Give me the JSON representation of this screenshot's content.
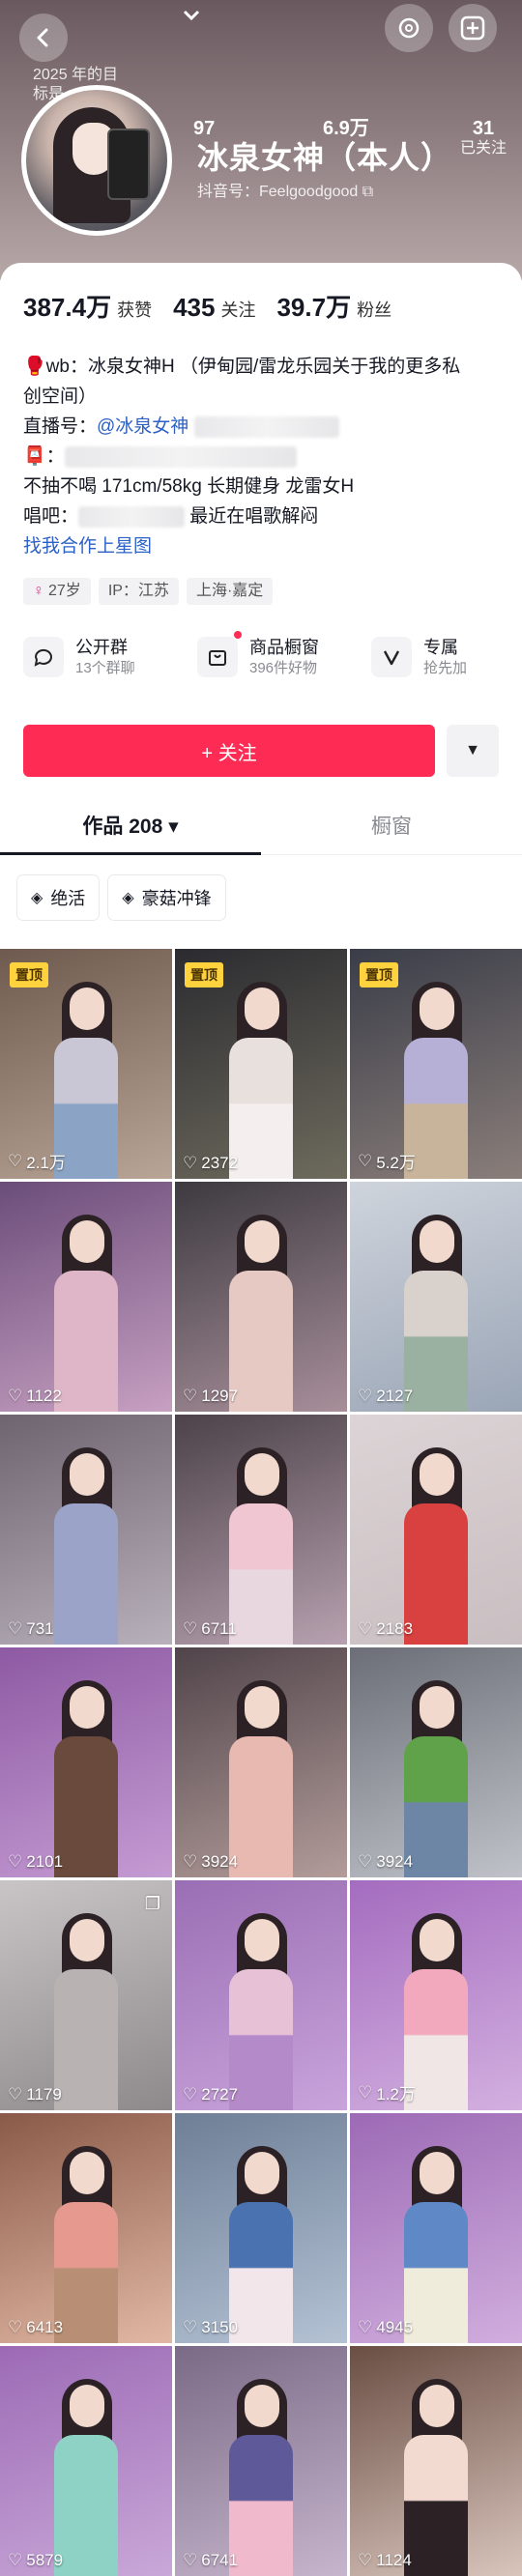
{
  "header": {
    "back_icon": "chevron-left-icon",
    "goal_text": [
      "2025 年的目",
      "标是"
    ],
    "top_icons": [
      "threads-icon",
      "plus-icon"
    ],
    "nickname": "冰泉女神（本人）",
    "douyin_id": "抖音号：Feelgoodgood",
    "header_stats": [
      {
        "value": "97",
        "label": ""
      },
      {
        "value": "6.9万",
        "label": ""
      },
      {
        "value": "31",
        "label": "已关注"
      }
    ]
  },
  "stats": [
    {
      "value": "387.4万",
      "label": "获赞"
    },
    {
      "value": "435",
      "label": "关注"
    },
    {
      "value": "39.7万",
      "label": "粉丝"
    }
  ],
  "bio": {
    "line1": "🥊wb：冰泉女神H （伊甸园/雷龙乐园关于我的更多私",
    "line2": "创空间）",
    "live_prefix": "直播号：",
    "live_link": "@冰泉女神",
    "mail_prefix": "📮：",
    "line5": "不抽不喝 171cm/58kg 长期健身 龙雷女H",
    "sing_prefix": "唱吧：",
    "sing_suffix": "最近在唱歌解闷",
    "collab_link": "找我合作上星图"
  },
  "tags": {
    "age": "27岁",
    "ip": "IP：江苏",
    "location": "上海·嘉定"
  },
  "entries": [
    {
      "title": "公开群",
      "sub": "13个群聊",
      "icon": "chat-group-icon"
    },
    {
      "title": "商品橱窗",
      "sub": "396件好物",
      "icon": "shop-bag-icon"
    },
    {
      "title": "专属",
      "sub": "抢先加",
      "icon": "v-badge-icon"
    }
  ],
  "follow_label": "+ 关注",
  "tabs": {
    "works": "作品 208 ▾",
    "showcase": "橱窗"
  },
  "collections": [
    {
      "label": "绝活",
      "icon": "layers-icon"
    },
    {
      "label": "豪菇冲锋",
      "icon": "layers-icon"
    }
  ],
  "pin_label": "置顶",
  "colors": {
    "accent": "#fe2c55",
    "link": "#2d61c5",
    "pin": "#ffd23e"
  },
  "videos": [
    {
      "likes": "2.1万",
      "pinned": true,
      "bg": [
        "#6e5a4e",
        "#b9a596"
      ],
      "top": "#c9c6d6",
      "bottom": "#8ba3c4"
    },
    {
      "likes": "2372",
      "pinned": true,
      "bg": [
        "#2b2b30",
        "#6e6b5d"
      ],
      "top": "#e8e0dc",
      "bottom": "#f4eeee"
    },
    {
      "likes": "5.2万",
      "pinned": true,
      "bg": [
        "#3a3d48",
        "#8a7e7a"
      ],
      "top": "#b7b0d6",
      "bottom": "#c7b49a"
    },
    {
      "likes": "1122",
      "pinned": false,
      "bg": [
        "#6b4d7a",
        "#c7a0c2"
      ],
      "top": "#dfb6c7",
      "bottom": "#dfb6c7"
    },
    {
      "likes": "1297",
      "pinned": false,
      "bg": [
        "#3d3a40",
        "#a88f9a"
      ],
      "top": "#e6c9c2",
      "bottom": "#e6c9c2"
    },
    {
      "likes": "2127",
      "pinned": false,
      "bg": [
        "#cfd4dc",
        "#9aa5b6"
      ],
      "top": "#d9d2cc",
      "bottom": "#9ab0a0"
    },
    {
      "likes": "731",
      "pinned": false,
      "bg": [
        "#6e6470",
        "#b8b0ba"
      ],
      "top": "#9ba3c8",
      "bottom": "#9ba3c8"
    },
    {
      "likes": "6711",
      "pinned": false,
      "bg": [
        "#4c4248",
        "#b7a1b0"
      ],
      "top": "#f0c6d2",
      "bottom": "#e8d7de"
    },
    {
      "likes": "2183",
      "pinned": false,
      "bg": [
        "#dcd4d6",
        "#c9bec1"
      ],
      "top": "#d8413f",
      "bottom": "#d8413f"
    },
    {
      "likes": "2101",
      "pinned": false,
      "bg": [
        "#8d5aa3",
        "#c59bd3"
      ],
      "top": "#6a4a3c",
      "bottom": "#6a4a3c"
    },
    {
      "likes": "3924",
      "pinned": false,
      "bg": [
        "#50444a",
        "#b39c9a"
      ],
      "top": "#e7b9b0",
      "bottom": "#e7b9b0"
    },
    {
      "likes": "3924",
      "pinned": false,
      "bg": [
        "#6b6e76",
        "#bfc3c9"
      ],
      "top": "#5fa24a",
      "bottom": "#6d86a6"
    },
    {
      "likes": "1179",
      "pinned": false,
      "multi": true,
      "bg": [
        "#c9c5c6",
        "#8e8a8c"
      ],
      "top": "#b8b2b3",
      "bottom": "#b8b2b3"
    },
    {
      "likes": "2727",
      "pinned": false,
      "bg": [
        "#9a6eb4",
        "#c9a4db"
      ],
      "top": "#e7c1d6",
      "bottom": "#b58ac9"
    },
    {
      "likes": "1.2万",
      "pinned": false,
      "bg": [
        "#a46cbf",
        "#d3b0e0"
      ],
      "top": "#f3a9bd",
      "bottom": "#f0e6e6"
    },
    {
      "likes": "6413",
      "pinned": false,
      "bg": [
        "#8a5a48",
        "#e2b8a4"
      ],
      "top": "#e69a8f",
      "bottom": "#b88f74"
    },
    {
      "likes": "3150",
      "pinned": false,
      "bg": [
        "#6e7f96",
        "#b4c2d4"
      ],
      "top": "#4a71b0",
      "bottom": "#f2e6ea"
    },
    {
      "likes": "4945",
      "pinned": false,
      "bg": [
        "#9c6ab5",
        "#d1aede"
      ],
      "top": "#5e88c6",
      "bottom": "#f0ecdc"
    },
    {
      "likes": "5879",
      "pinned": false,
      "bg": [
        "#9c6ab5",
        "#c9a8d8"
      ],
      "top": "#8dd2c5",
      "bottom": "#8dd2c5"
    },
    {
      "likes": "6741",
      "pinned": false,
      "bg": [
        "#7a6a86",
        "#c6b5cc"
      ],
      "top": "#5e5a9a",
      "bottom": "#f1b9cc"
    },
    {
      "likes": "1124",
      "pinned": false,
      "bg": [
        "#6a4e44",
        "#d9c5bc"
      ],
      "top": "#f2dad0",
      "bottom": "#2c2226"
    }
  ]
}
